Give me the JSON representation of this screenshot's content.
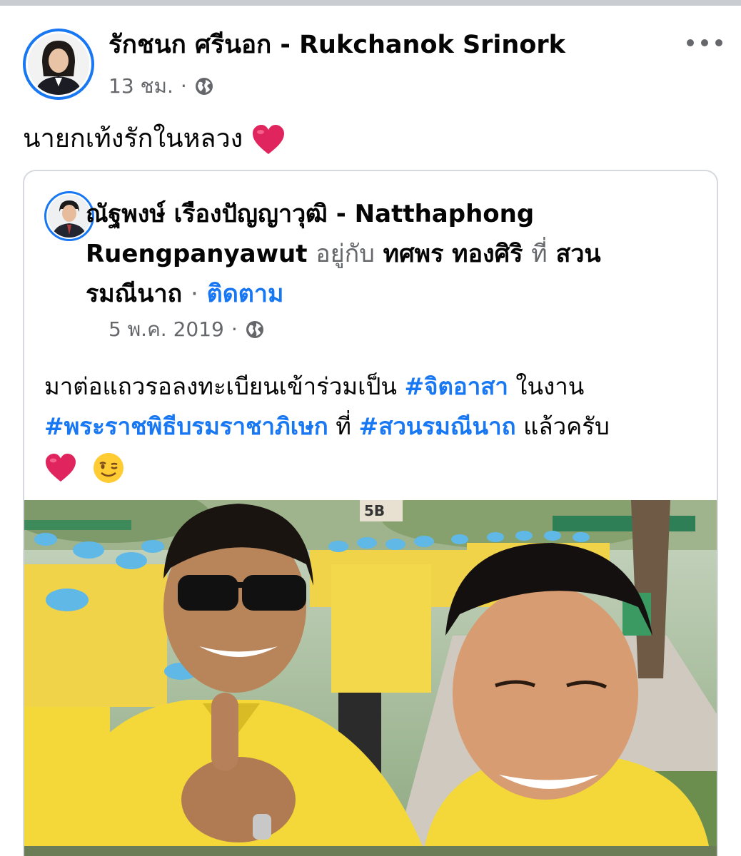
{
  "post": {
    "author": "รักชนก ศรีนอก - Rukchanok Srinork",
    "time": "13 ชม.",
    "separator": "·",
    "text": "นายกเท้งรักในหลวง"
  },
  "shared": {
    "author_line1": "ณัฐพงษ์ เรืองปัญญาวุฒิ - Natthaphong",
    "author_line2": "Ruengpanyawut",
    "with_word": "อยู่กับ",
    "with_person": "ทศพร ทองศิริ",
    "at_word": "ที่",
    "place_part1": "สวน",
    "place_part2": "รมณีนาถ",
    "separator": "·",
    "follow_label": "ติดตาม",
    "date": "5 พ.ค. 2019",
    "body_text1": "มาต่อแถวรอลงทะเบียนเข้าร่วมเป็น",
    "hashtag1": "#จิตอาสา",
    "body_text2": "ในงาน",
    "hashtag2": "#พระราชพิธีบรมราชาภิเษก",
    "body_text3": "ที่",
    "hashtag3": "#สวนรมณีนาถ",
    "body_text4": "แล้วครับ",
    "sign_text": "5B"
  },
  "icons": {
    "privacy": "globe-icon",
    "more": "more-options-icon",
    "reaction1": "red-heart-emoji",
    "reaction2": "winking-face-emoji"
  },
  "colors": {
    "link_blue": "#1877f2",
    "muted_gray": "#65676b",
    "heart_red": "#e0245e",
    "shirt_yellow": "#f4d83a",
    "cap_blue": "#5fb8e6"
  }
}
